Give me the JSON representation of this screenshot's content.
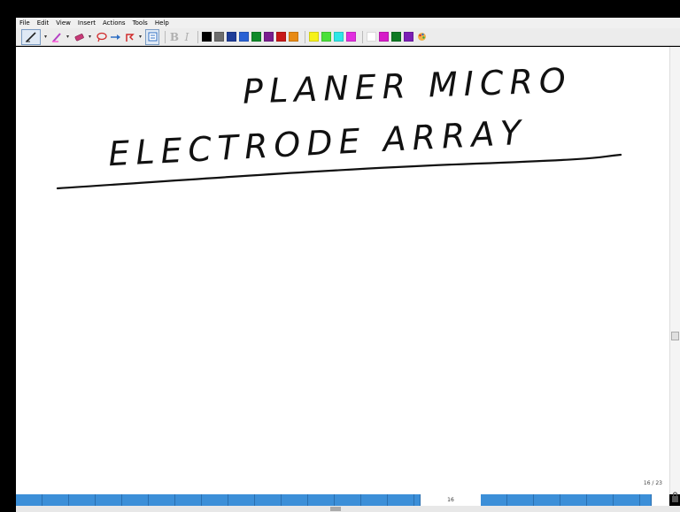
{
  "menu": [
    "File",
    "Edit",
    "View",
    "Insert",
    "Actions",
    "Tools",
    "Help"
  ],
  "toolbar": {
    "tools": [
      "pen-tool",
      "highlighter",
      "eraser",
      "lasso-select",
      "insert-space",
      "pointer",
      "text-box"
    ],
    "format": {
      "bold": "B",
      "italic": "I"
    },
    "colors": [
      "#000000",
      "#6d6d6d",
      "#1f3d99",
      "#2a62d4",
      "#0f8a2a",
      "#7a1f8f",
      "#c81818",
      "#e88a14",
      "#f6f21a",
      "#4ae13a",
      "#2ee7e7",
      "#e22ee0",
      "#ffffff",
      "#d61cc8",
      "#0e7a24",
      "#7b1fb5"
    ]
  },
  "canvas": {
    "handwritten_line1": "PLANER MICRO",
    "handwritten_line2": "ELECTRODE ARRAY"
  },
  "page_counter": "16 / 23",
  "current_page": "16"
}
